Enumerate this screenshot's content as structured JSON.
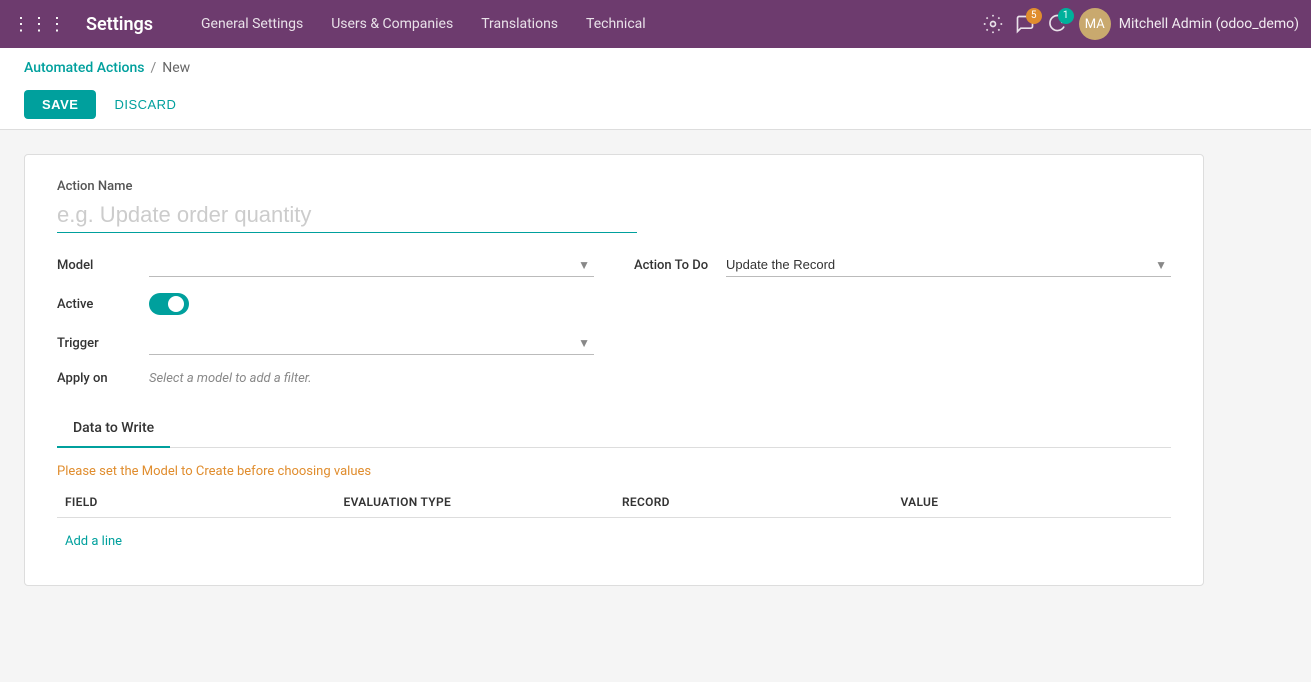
{
  "topnav": {
    "brand": "Settings",
    "menu_items": [
      {
        "label": "General Settings",
        "id": "general-settings"
      },
      {
        "label": "Users & Companies",
        "id": "users-companies"
      },
      {
        "label": "Translations",
        "id": "translations"
      },
      {
        "label": "Technical",
        "id": "technical"
      }
    ],
    "messages_badge": "5",
    "activity_badge": "1",
    "user_name": "Mitchell Admin (odoo_demo)"
  },
  "breadcrumb": {
    "parent_label": "Automated Actions",
    "separator": "/",
    "current_label": "New"
  },
  "toolbar": {
    "save_label": "SAVE",
    "discard_label": "DISCARD"
  },
  "form": {
    "action_name_label": "Action Name",
    "action_name_placeholder": "e.g. Update order quantity",
    "model_label": "Model",
    "model_value": "",
    "active_label": "Active",
    "trigger_label": "Trigger",
    "trigger_value": "",
    "apply_on_label": "Apply on",
    "apply_on_placeholder": "Select a model to add a filter.",
    "action_to_do_label": "Action To Do",
    "action_to_do_value": "Update the Record"
  },
  "tabs": [
    {
      "label": "Data to Write",
      "active": true
    }
  ],
  "data_write": {
    "info_message": "Please set the Model to Create before choosing values",
    "columns": [
      "Field",
      "Evaluation Type",
      "Record",
      "Value"
    ],
    "add_line_label": "Add a line"
  }
}
